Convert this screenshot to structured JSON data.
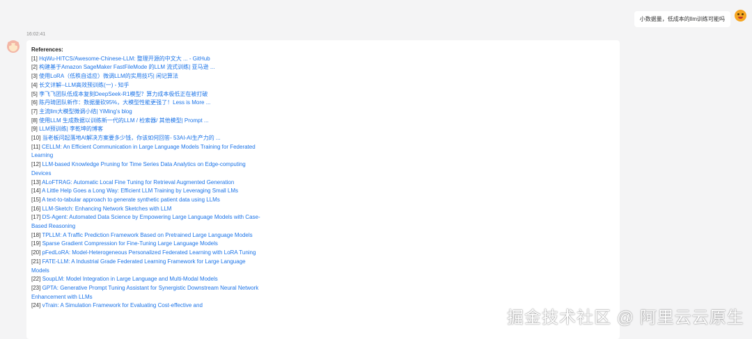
{
  "user_message": "小数据量，低成本的llm训练可能吗",
  "timestamp": "16:02:41",
  "references": {
    "title": "References:",
    "items": [
      {
        "num": "[1]",
        "text": "HqWu-HITCS/Awesome-Chinese-LLM: 整理开源的中文大 ... - GitHub"
      },
      {
        "num": "[2]",
        "text": "构建基于Amazon SageMaker FastFileMode 的LLM 流式训练| 亚马逊 ..."
      },
      {
        "num": "[3]",
        "text": "使用LoRA（低秩自适应）微调LLM的实用技巧| 闲记算法"
      },
      {
        "num": "[4]",
        "text": "长文详解--LLM高效预训练(一) - 知乎"
      },
      {
        "num": "[5]",
        "text": "李飞飞团队低成本复刻DeepSeek-R1模型？算力成本极低正在被打破"
      },
      {
        "num": "[6]",
        "text": "陈丹琦团队新作：数据量砍95%，大模型性能更强了！Less is More ..."
      },
      {
        "num": "[7]",
        "text": "主流llm大模型微调小结| YiMing's blog"
      },
      {
        "num": "[8]",
        "text": "使用LLM 生成数据以训练新一代的LLM / 检索器/ 其他模型| Prompt ..."
      },
      {
        "num": "[9]",
        "text": "LLM预训练| 李乾坤的博客"
      },
      {
        "num": "[10]",
        "text": "当老板问起落地AI解决方案要多少钱，你该如何回答- 53AI-AI生产力的 ..."
      },
      {
        "num": "[11]",
        "text": "CELLM: An Efficient Communication in Large Language Models Training for Federated Learning"
      },
      {
        "num": "[12]",
        "text": "LLM-based Knowledge Pruning for Time Series Data Analytics on Edge-computing Devices"
      },
      {
        "num": "[13]",
        "text": "ALoFTRAG: Automatic Local Fine Tuning for Retrieval Augmented Generation"
      },
      {
        "num": "[14]",
        "text": "A Little Help Goes a Long Way: Efficient LLM Training by Leveraging Small LMs"
      },
      {
        "num": "[15]",
        "text": "A text-to-tabular approach to generate synthetic patient data using LLMs"
      },
      {
        "num": "[16]",
        "text": "LLM-Sketch: Enhancing Network Sketches with LLM"
      },
      {
        "num": "[17]",
        "text": "DS-Agent: Automated Data Science by Empowering Large Language Models with Case-Based Reasoning"
      },
      {
        "num": "[18]",
        "text": "TPLLM: A Traffic Prediction Framework Based on Pretrained Large Language Models"
      },
      {
        "num": "[19]",
        "text": "Sparse Gradient Compression for Fine-Tuning Large Language Models"
      },
      {
        "num": "[20]",
        "text": "pFedLoRA: Model-Heterogeneous Personalized Federated Learning with LoRA Tuning"
      },
      {
        "num": "[21]",
        "text": "FATE-LLM: A Industrial Grade Federated Learning Framework for Large Language Models"
      },
      {
        "num": "[22]",
        "text": "SoupLM: Model Integration in Large Language and Multi-Modal Models"
      },
      {
        "num": "[23]",
        "text": "GPTA: Generative Prompt Tuning Assistant for Synergistic Downstream Neural Network Enhancement with LLMs"
      },
      {
        "num": "[24]",
        "text": "vTrain: A Simulation Framework for Evaluating Cost-effective and"
      }
    ]
  },
  "watermark": "掘金技术社区 @ 阿里云云原生"
}
